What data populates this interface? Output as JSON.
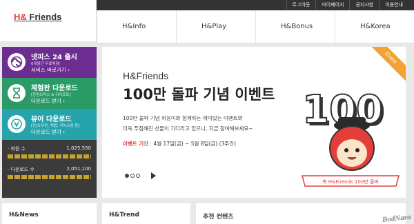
{
  "brand": {
    "logo_hf": "H&",
    "logo_rest": "Friends"
  },
  "topnav": [
    "로그아웃",
    "마이페이지",
    "공지사항",
    "이용안내"
  ],
  "mainnav": [
    "H&Info",
    "H&Play",
    "H&Bonus",
    "H&Korea"
  ],
  "sidebar": {
    "cards": [
      {
        "title": "넷피스 24 출시",
        "sub": "6개월간 무료체험!",
        "link": "서비스 바로가기 ›",
        "color": "#6b2d8f"
      },
      {
        "title": "체험판 다운로드",
        "sub": "[한컴오피스 & 이지포토]",
        "link": "다운로드 받기 ›",
        "color": "#2a9b67"
      },
      {
        "title": "뷰어 다운로드",
        "sub": "[한/오우윈, 맥용, 리눅스용 등]",
        "link": "다운로드 받기 ›",
        "color": "#27a4ab"
      }
    ],
    "stats": [
      {
        "label": "· 회원 수",
        "value": "1,025,550"
      },
      {
        "label": "· 다운로드 수",
        "value": "2,051,100"
      }
    ]
  },
  "banner": {
    "brand": "H&Friends",
    "headline": "100만 돌파 기념 이벤트",
    "desc_1": "100만 돌파 기념 히응이와 함께하는 재미있는 이벤트와",
    "desc_2": "더욱 푸짐해진 선물이 기다리고 있으니, 지금 참여해보세요~",
    "period_label": "이벤트 기간",
    "period_value": ": 4월 17일(금) ~ 5월 8일(금) (3주간)",
    "tag": "Event",
    "art_number": "100",
    "art_ribbon": "축 H&Friends 100만 돌파"
  },
  "panels": [
    "H&News",
    "H&Trend",
    "추천 컨텐츠"
  ],
  "watermark": "BodNara",
  "colors": {
    "accent": "#e43e3a",
    "purple": "#6b2d8f",
    "green": "#2a9b67",
    "teal": "#27a4ab",
    "gold": "#c7a22f",
    "event": "#f2a331"
  }
}
